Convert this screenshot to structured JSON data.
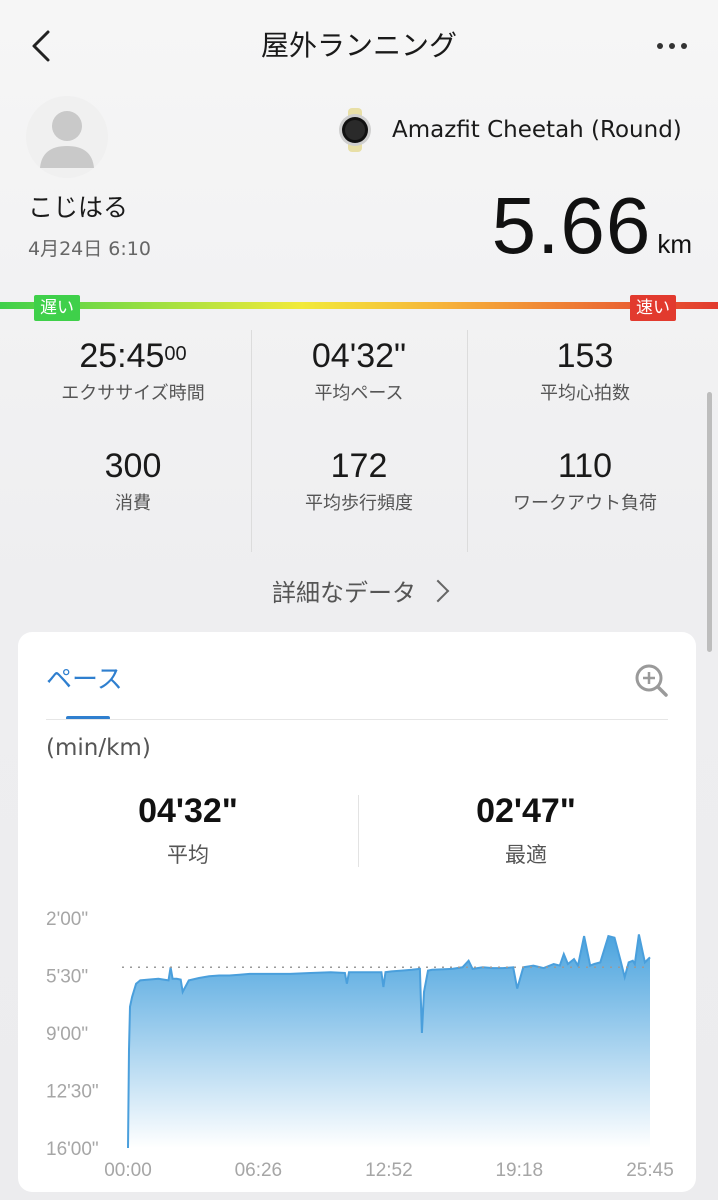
{
  "header": {
    "title": "屋外ランニング",
    "back_icon": "chevron-left-icon",
    "more_icon": "more-horizontal-icon"
  },
  "profile": {
    "username": "こじはる",
    "datetime": "4月24日 6:10",
    "avatar_icon": "user-silhouette-icon"
  },
  "device": {
    "name": "Amazfit Cheetah (Round)",
    "icon": "watch-icon"
  },
  "distance": {
    "value": "5.66",
    "unit": "km"
  },
  "speed_scale": {
    "slow": "遅い",
    "fast": "速い",
    "slow_color": "#3fd04a",
    "fast_color": "#e23a2e"
  },
  "stats": [
    {
      "value": "25:45",
      "sup": "00",
      "label": "エクササイズ時間"
    },
    {
      "value": "04'32\"",
      "sup": "",
      "label": "平均ペース"
    },
    {
      "value": "153",
      "sup": "",
      "label": "平均心拍数"
    },
    {
      "value": "300",
      "sup": "",
      "label": "消費"
    },
    {
      "value": "172",
      "sup": "",
      "label": "平均歩行頻度"
    },
    {
      "value": "110",
      "sup": "",
      "label": "ワークアウト負荷"
    }
  ],
  "details_link": "詳細なデータ",
  "pace_card": {
    "tab": "ペース",
    "unit": "(min/km)",
    "accent_color": "#2f7fcf",
    "average": {
      "value": "04'32\"",
      "label": "平均"
    },
    "best": {
      "value": "02'47\"",
      "label": "最適"
    },
    "zoom_icon": "zoom-in-icon"
  },
  "chart_data": {
    "type": "area",
    "title": "",
    "xlabel": "",
    "ylabel": "",
    "y_tick_labels": [
      "2'00\"",
      "5'30\"",
      "9'00\"",
      "12'30\"",
      "16'00\""
    ],
    "y_ticks_minutes": [
      2,
      5.5,
      9,
      12.5,
      16
    ],
    "ylim": [
      16,
      2
    ],
    "y_inverted": true,
    "x_tick_labels": [
      "00:00",
      "06:26",
      "12:52",
      "19:18",
      "25:45"
    ],
    "x_ticks_minutes": [
      0,
      6.43,
      12.87,
      19.3,
      25.75
    ],
    "xlim": [
      0,
      25.75
    ],
    "average_line_minutes": 5.0,
    "series": [
      {
        "color": "#4a9fdc",
        "x": [
          0,
          0.05,
          0.1,
          0.2,
          0.4,
          0.5,
          0.6,
          1,
          1.5,
          2,
          2.1,
          2.2,
          2.4,
          2.6,
          2.7,
          3,
          3.5,
          4,
          4.5,
          5,
          5.5,
          6,
          7,
          8,
          9,
          10,
          10.7,
          10.8,
          10.9,
          11,
          12,
          12.5,
          12.6,
          12.7,
          13,
          13.5,
          14,
          14.4,
          14.5,
          14.6,
          14.8,
          15,
          16,
          16.5,
          16.8,
          17,
          17.5,
          18,
          18.5,
          19,
          19.2,
          19.5,
          20,
          20.5,
          21,
          21.3,
          21.5,
          21.7,
          22,
          22.2,
          22.5,
          22.8,
          23,
          23.3,
          23.7,
          24,
          24.3,
          24.5,
          24.7,
          24.9,
          25,
          25.2,
          25.5,
          25.75
        ],
        "pace_minutes": [
          16,
          10,
          7.4,
          6.8,
          6.0,
          5.9,
          5.8,
          5.75,
          5.7,
          5.8,
          5.0,
          5.7,
          5.7,
          5.75,
          6.5,
          5.8,
          5.65,
          5.55,
          5.5,
          5.5,
          5.45,
          5.4,
          5.4,
          5.4,
          5.35,
          5.3,
          5.35,
          6.0,
          5.3,
          5.3,
          5.3,
          5.3,
          6.2,
          5.3,
          5.25,
          5.2,
          5.15,
          5.1,
          9.0,
          6.5,
          5.2,
          5.15,
          5.1,
          5.0,
          4.6,
          5.1,
          5.0,
          5.05,
          5.05,
          5.0,
          6.3,
          5.0,
          4.9,
          5.05,
          4.8,
          4.9,
          4.2,
          4.8,
          4.5,
          4.9,
          3.1,
          4.9,
          4.8,
          4.7,
          3.1,
          3.2,
          4.6,
          5.6,
          4.7,
          4.6,
          4.8,
          3.0,
          4.7,
          4.4
        ]
      }
    ]
  }
}
